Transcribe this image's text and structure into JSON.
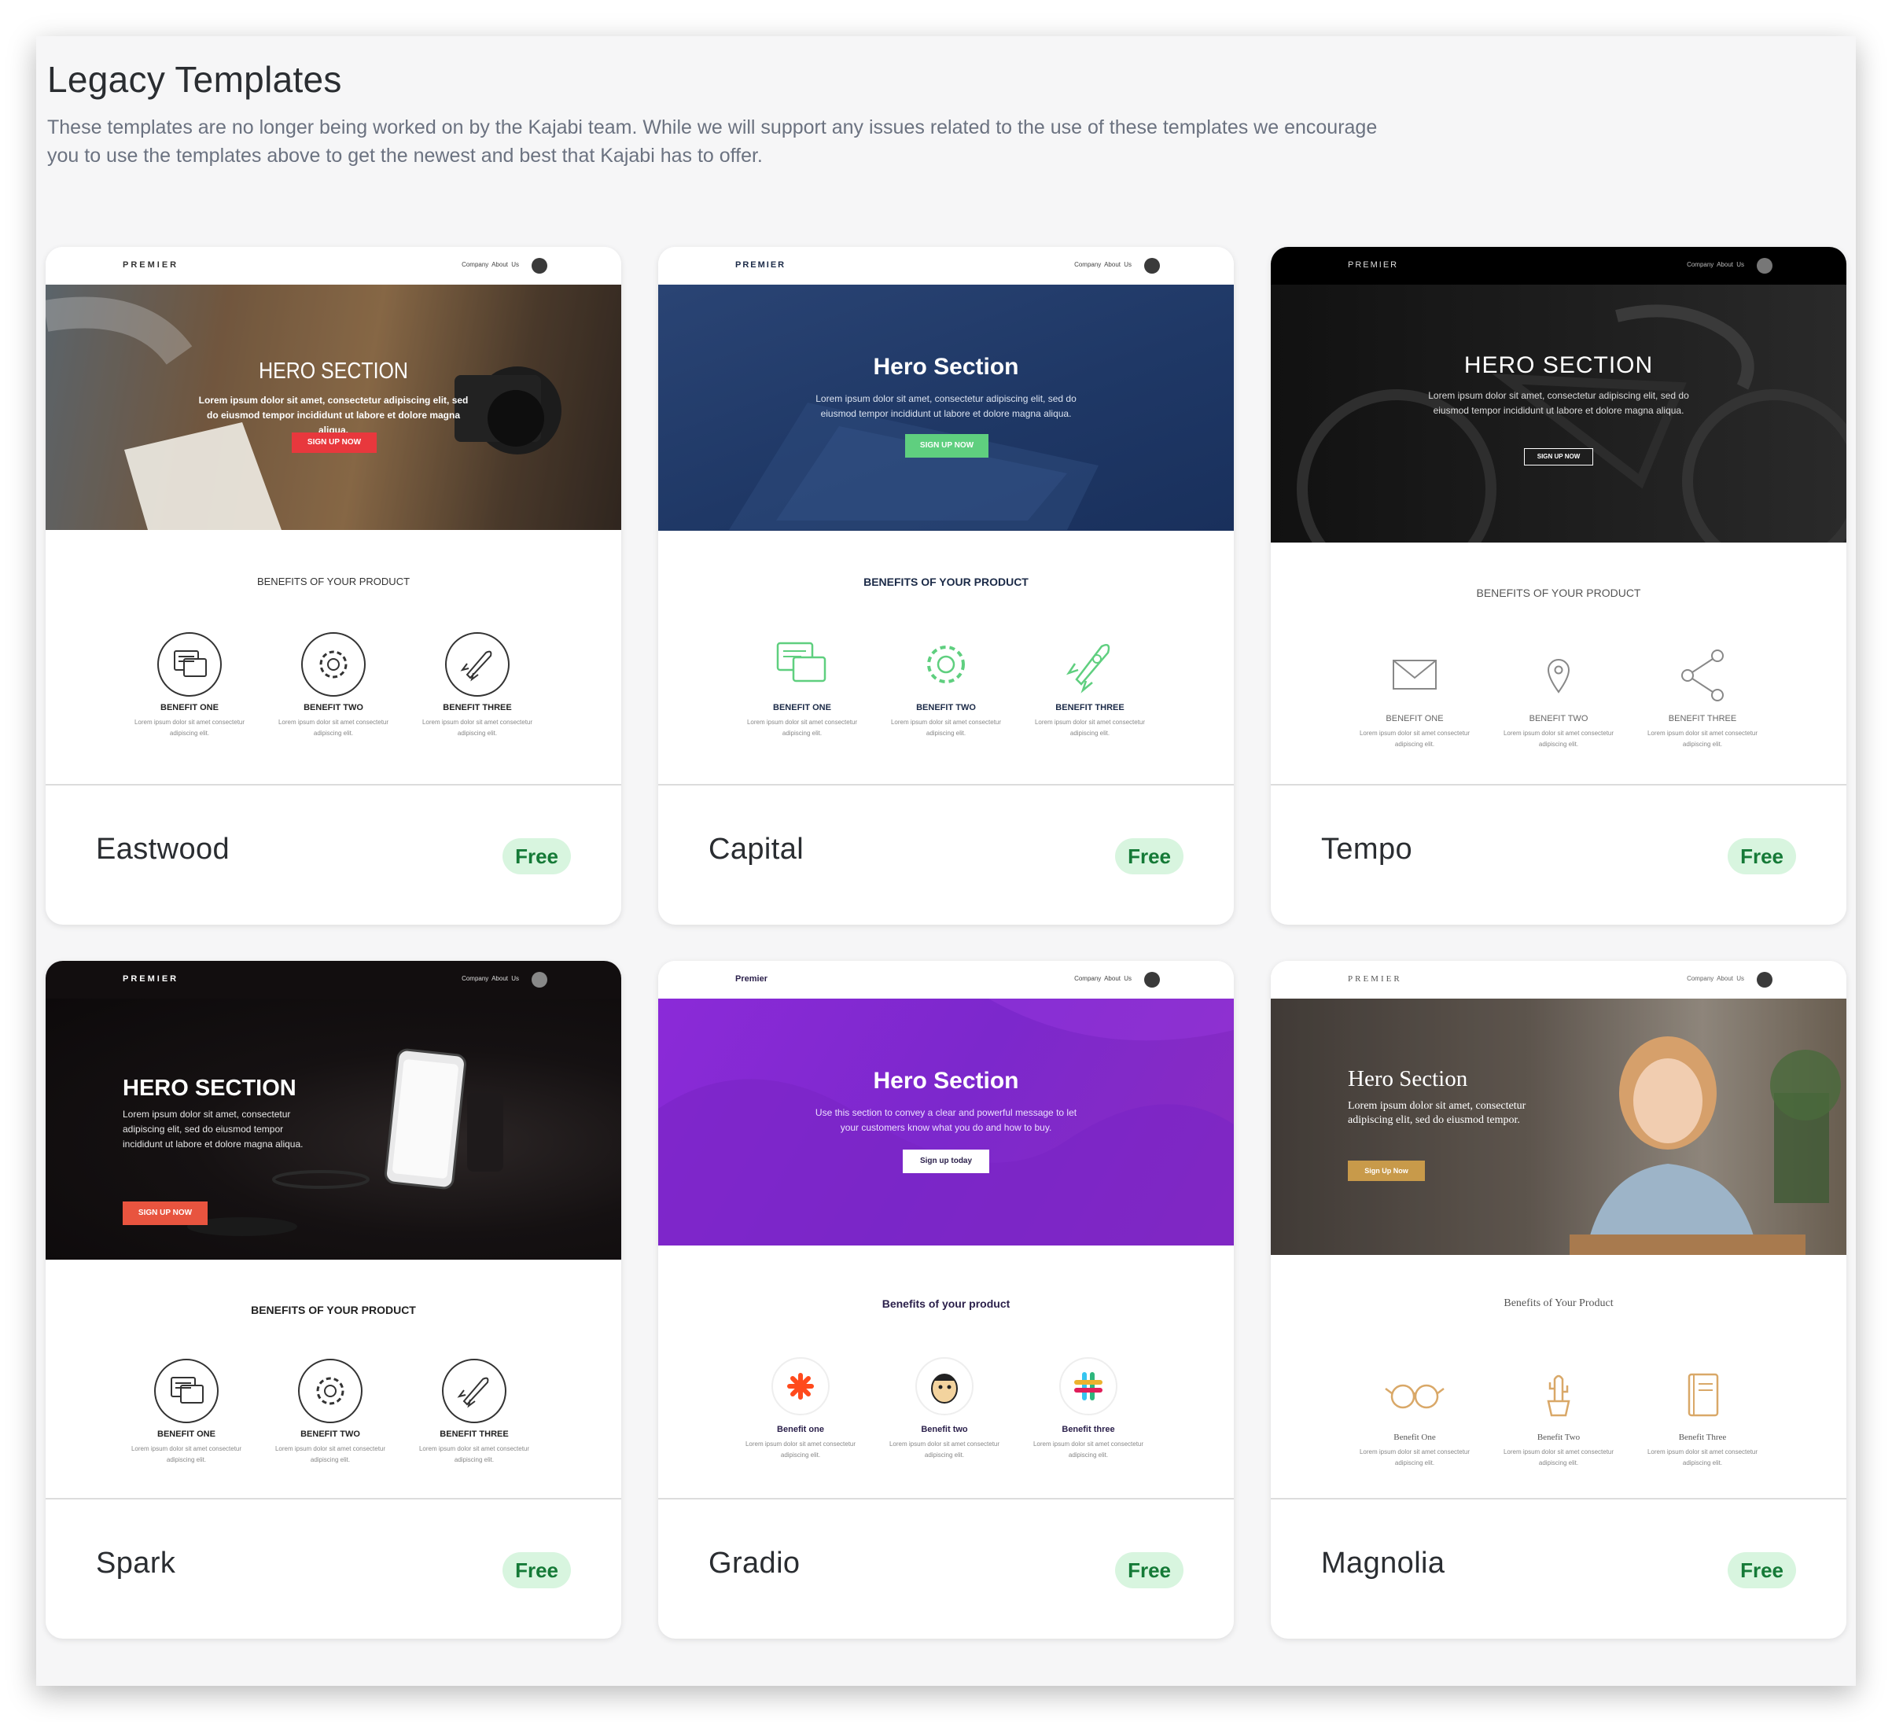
{
  "section": {
    "title": "Legacy Templates",
    "description": "These templates are no longer being worked on by the Kajabi team. While we will support any issues related to the use of these templates we encourage you to use the templates above to get the newest and best that Kajabi has to offer."
  },
  "cards": [
    {
      "name": "Eastwood",
      "badge": "Free",
      "preview": {
        "logo": "PREMIER",
        "nav": "Company  About Us",
        "hero_title": "HERO SECTION",
        "hero_text": "Lorem ipsum dolor sit amet, consectetur adipiscing elit, sed do eiusmod tempor incididunt ut labore et dolore magna aliqua.",
        "cta": "SIGN UP NOW",
        "benefits_title": "BENEFITS OF YOUR PRODUCT",
        "benefits": [
          {
            "icon": "chat-icon",
            "label": "BENEFIT ONE",
            "text": "Lorem ipsum dolor sit amet consectetur adipiscing elit."
          },
          {
            "icon": "gear-icon",
            "label": "BENEFIT TWO",
            "text": "Lorem ipsum dolor sit amet consectetur adipiscing elit."
          },
          {
            "icon": "rocket-icon",
            "label": "BENEFIT THREE",
            "text": "Lorem ipsum dolor sit amet consectetur adipiscing elit."
          }
        ]
      }
    },
    {
      "name": "Capital",
      "badge": "Free",
      "preview": {
        "logo": "PREMIER",
        "nav": "Company  About Us",
        "hero_title": "Hero Section",
        "hero_text": "Lorem ipsum dolor sit amet, consectetur adipiscing elit, sed do eiusmod tempor incididunt ut labore et dolore magna aliqua.",
        "cta": "SIGN UP NOW",
        "benefits_title": "BENEFITS OF YOUR PRODUCT",
        "benefits": [
          {
            "icon": "chat-icon",
            "label": "BENEFIT ONE",
            "text": "Lorem ipsum dolor sit amet consectetur adipiscing elit."
          },
          {
            "icon": "gear-icon",
            "label": "BENEFIT TWO",
            "text": "Lorem ipsum dolor sit amet consectetur adipiscing elit."
          },
          {
            "icon": "rocket-icon",
            "label": "BENEFIT THREE",
            "text": "Lorem ipsum dolor sit amet consectetur adipiscing elit."
          }
        ]
      }
    },
    {
      "name": "Tempo",
      "badge": "Free",
      "preview": {
        "logo": "PREMIER",
        "nav": "Company  About Us",
        "hero_title": "HERO SECTION",
        "hero_text": "Lorem ipsum dolor sit amet, consectetur adipiscing elit, sed do eiusmod tempor incididunt ut labore et dolore magna aliqua.",
        "cta": "SIGN UP NOW",
        "benefits_title": "BENEFITS OF YOUR PRODUCT",
        "benefits": [
          {
            "icon": "envelope-icon",
            "label": "BENEFIT ONE",
            "text": "Lorem ipsum dolor sit amet consectetur adipiscing elit."
          },
          {
            "icon": "map-pin-icon",
            "label": "BENEFIT TWO",
            "text": "Lorem ipsum dolor sit amet consectetur adipiscing elit."
          },
          {
            "icon": "share-icon",
            "label": "BENEFIT THREE",
            "text": "Lorem ipsum dolor sit amet consectetur adipiscing elit."
          }
        ]
      }
    },
    {
      "name": "Spark",
      "badge": "Free",
      "preview": {
        "logo": "PREMIER",
        "nav": "Company  About Us",
        "hero_title": "HERO SECTION",
        "hero_text": "Lorem ipsum dolor sit amet, consectetur adipiscing elit, sed do eiusmod tempor incididunt ut labore et dolore magna aliqua.",
        "cta": "SIGN UP NOW",
        "benefits_title": "BENEFITS OF YOUR PRODUCT",
        "benefits": [
          {
            "icon": "chat-icon",
            "label": "BENEFIT ONE",
            "text": "Lorem ipsum dolor sit amet consectetur adipiscing elit."
          },
          {
            "icon": "gear-icon",
            "label": "BENEFIT TWO",
            "text": "Lorem ipsum dolor sit amet consectetur adipiscing elit."
          },
          {
            "icon": "rocket-icon",
            "label": "BENEFIT THREE",
            "text": "Lorem ipsum dolor sit amet consectetur adipiscing elit."
          }
        ]
      }
    },
    {
      "name": "Gradio",
      "badge": "Free",
      "preview": {
        "logo": "Premier",
        "nav": "Company  About Us",
        "hero_title": "Hero Section",
        "hero_text": "Use this section to convey a clear and powerful message to let your customers know what you do and how to buy.",
        "cta": "Sign up today",
        "benefits_title": "Benefits of your product",
        "benefits": [
          {
            "icon": "asterisk-logo-icon",
            "label": "Benefit one",
            "text": "Lorem ipsum dolor sit amet consectetur adipiscing elit."
          },
          {
            "icon": "monkey-logo-icon",
            "label": "Benefit two",
            "text": "Lorem ipsum dolor sit amet consectetur adipiscing elit."
          },
          {
            "icon": "slack-logo-icon",
            "label": "Benefit three",
            "text": "Lorem ipsum dolor sit amet consectetur adipiscing elit."
          }
        ]
      }
    },
    {
      "name": "Magnolia",
      "badge": "Free",
      "preview": {
        "logo": "PREMIER",
        "nav": "Company  About Us",
        "hero_title": "Hero Section",
        "hero_text": "Lorem ipsum dolor sit amet, consectetur adipiscing elit, sed do eiusmod tempor.",
        "cta": "Sign Up Now",
        "benefits_title": "Benefits of Your Product",
        "benefits": [
          {
            "icon": "glasses-icon",
            "label": "Benefit One",
            "text": "Lorem ipsum dolor sit amet consectetur adipiscing elit."
          },
          {
            "icon": "cactus-icon",
            "label": "Benefit Two",
            "text": "Lorem ipsum dolor sit amet consectetur adipiscing elit."
          },
          {
            "icon": "notebook-icon",
            "label": "Benefit Three",
            "text": "Lorem ipsum dolor sit amet consectetur adipiscing elit."
          }
        ]
      }
    }
  ]
}
